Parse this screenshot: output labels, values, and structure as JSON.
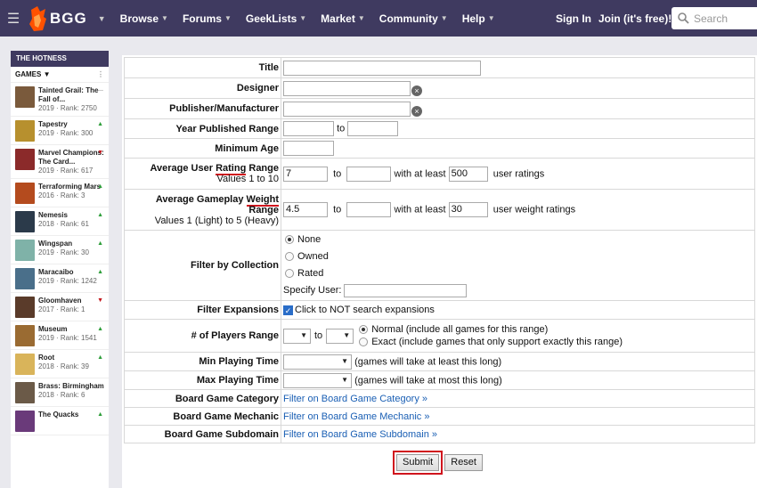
{
  "nav": {
    "logo": "BGG",
    "menu": [
      "Browse",
      "Forums",
      "GeekLists",
      "Market",
      "Community",
      "Help"
    ],
    "sign_in": "Sign In",
    "join": "Join (it's free)!",
    "search_placeholder": "Search"
  },
  "sidebar": {
    "header": "THE HOTNESS",
    "filter": "GAMES",
    "items": [
      {
        "name": "Tainted Grail: The Fall of...",
        "meta": "2019 · Rank: 2750",
        "trend": "flat",
        "color": "#7a5a3c"
      },
      {
        "name": "Tapestry",
        "meta": "2019 · Rank: 300",
        "trend": "up",
        "color": "#b7902e"
      },
      {
        "name": "Marvel Champions: The Card...",
        "meta": "2019 · Rank: 617",
        "trend": "down",
        "color": "#8b2a2a"
      },
      {
        "name": "Terraforming Mars",
        "meta": "2016 · Rank: 3",
        "trend": "up",
        "color": "#b44b1e"
      },
      {
        "name": "Nemesis",
        "meta": "2018 · Rank: 61",
        "trend": "up",
        "color": "#2b3a4a"
      },
      {
        "name": "Wingspan",
        "meta": "2019 · Rank: 30",
        "trend": "up",
        "color": "#7fb2a8"
      },
      {
        "name": "Maracaibo",
        "meta": "2019 · Rank: 1242",
        "trend": "up",
        "color": "#4a6f8a"
      },
      {
        "name": "Gloomhaven",
        "meta": "2017 · Rank: 1",
        "trend": "down",
        "color": "#5a3b2a"
      },
      {
        "name": "Museum",
        "meta": "2019 · Rank: 1541",
        "trend": "up",
        "color": "#9a6b32"
      },
      {
        "name": "Root",
        "meta": "2018 · Rank: 39",
        "trend": "up",
        "color": "#d9b45a"
      },
      {
        "name": "Brass: Birmingham",
        "meta": "2018 · Rank: 6",
        "trend": "flat",
        "color": "#6b5a48"
      },
      {
        "name": "The Quacks",
        "meta": "",
        "trend": "up",
        "color": "#6a3a7a"
      }
    ]
  },
  "form": {
    "title_label": "Title",
    "designer_label": "Designer",
    "publisher_label": "Publisher/Manufacturer",
    "year_label": "Year Published Range",
    "to": "to",
    "min_age_label": "Minimum Age",
    "rating_label_a": "Average User ",
    "rating_label_b": "Rating",
    "rating_label_c": " Range",
    "rating_sub": "Values 1 to 10",
    "rating_min": "7",
    "rating_users": "500",
    "with_at_least": "with at least",
    "user_ratings": "user ratings",
    "weight_label_a": "Average Gameplay ",
    "weight_label_b": "Weight",
    "weight_label_c": "Range",
    "weight_sub": "Values 1 (Light) to 5 (Heavy)",
    "weight_min": "4.5",
    "weight_users": "30",
    "user_weight_ratings": "user weight ratings",
    "collection_label": "Filter by Collection",
    "coll_none": "None",
    "coll_owned": "Owned",
    "coll_rated": "Rated",
    "specify_user": "Specify User:",
    "expansions_label": "Filter Expansions",
    "expansions_text": "Click to NOT search expansions",
    "players_label": "# of Players Range",
    "players_normal": "Normal (include all games for this range)",
    "players_exact": "Exact (include games that only support exactly this range)",
    "min_time_label": "Min Playing Time",
    "min_time_text": "(games will take at least this long)",
    "max_time_label": "Max Playing Time",
    "max_time_text": "(games will take at most this long)",
    "category_label": "Board Game Category",
    "category_link": "Filter on Board Game Category »",
    "mechanic_label": "Board Game Mechanic",
    "mechanic_link": "Filter on Board Game Mechanic »",
    "subdomain_label": "Board Game Subdomain",
    "subdomain_link": "Filter on Board Game Subdomain »",
    "submit": "Submit",
    "reset": "Reset"
  }
}
